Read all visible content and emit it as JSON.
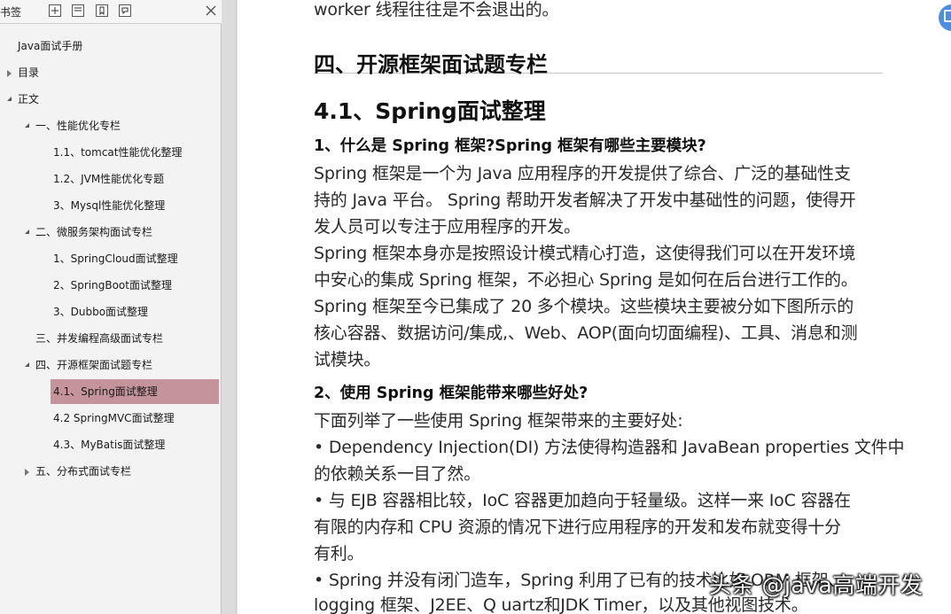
{
  "sidebar": {
    "title": "书签",
    "toolbar_icons": [
      "expand-all-icon",
      "collapse-all-icon",
      "add-bookmark-icon",
      "bookmark-icon"
    ],
    "close_icon": "close-icon",
    "items": [
      {
        "label": "Java面试手册",
        "expander": "none"
      },
      {
        "label": "目录",
        "expander": "closed"
      },
      {
        "label": "正文",
        "expander": "open"
      },
      {
        "label": "一、性能优化专栏",
        "expander": "open"
      },
      {
        "label": "1.1、tomcat性能优化整理",
        "expander": "none"
      },
      {
        "label": "1.2、JVM性能优化专题",
        "expander": "none"
      },
      {
        "label": "3、Mysql性能优化整理",
        "expander": "none"
      },
      {
        "label": "二、微服务架构面试专栏",
        "expander": "open"
      },
      {
        "label": "1、SpringCloud面试整理",
        "expander": "none"
      },
      {
        "label": "2、SpringBoot面试整理",
        "expander": "none"
      },
      {
        "label": "3、Dubbo面试整理",
        "expander": "none"
      },
      {
        "label": "三、并发编程高级面试专栏",
        "expander": "none"
      },
      {
        "label": "四、开源框架面试题专栏",
        "expander": "open"
      },
      {
        "label": "4.1、Spring面试整理",
        "expander": "none",
        "selected": true
      },
      {
        "label": "4.2 SpringMVC面试整理",
        "expander": "none"
      },
      {
        "label": "4.3、MyBatis面试整理",
        "expander": "none"
      },
      {
        "label": "五、分布式面试专栏",
        "expander": "closed"
      }
    ],
    "selected_color": "#c4939b"
  },
  "document": {
    "lines": [
      {
        "text": "worker 线程往往是不会退出的。",
        "style": "body"
      },
      {
        "text": "四、开源框架面试题专栏",
        "style": "h1"
      },
      {
        "text": "4.1、Spring面试整理",
        "style": "h2"
      },
      {
        "text": "1、什么是 Spring 框架?Spring 框架有哪些主要模块?",
        "style": "h3"
      },
      {
        "text": "Spring 框架是一个为 Java 应用程序的开发提供了综合、广泛的基础性支",
        "style": "body"
      },
      {
        "text": "持的 Java 平台。 Spring 帮助开发者解决了开发中基础性的问题，使得开",
        "style": "body"
      },
      {
        "text": "发人员可以专注于应用程序的开发。",
        "style": "body"
      },
      {
        "text": "Spring 框架本身亦是按照设计模式精心打造，这使得我们可以在开发环境",
        "style": "body"
      },
      {
        "text": "中安心的集成 Spring 框架，不必担心 Spring 是如何在后台进行工作的。",
        "style": "body"
      },
      {
        "text": "Spring 框架至今已集成了 20 多个模块。这些模块主要被分如下图所示的",
        "style": "body"
      },
      {
        "text": "核心容器、数据访问/集成,、Web、AOP(面向切面编程)、工具、消息和测",
        "style": "body"
      },
      {
        "text": "试模块。",
        "style": "body"
      },
      {
        "text": "2、使用 Spring 框架能带来哪些好处?",
        "style": "h3"
      },
      {
        "text": "下面列举了一些使用 Spring 框架带来的主要好处:",
        "style": "body"
      },
      {
        "text": "• Dependency Injection(DI) 方法使得构造器和 JavaBean properties 文件中",
        "style": "body"
      },
      {
        "text": "的依赖关系一目了然。",
        "style": "body"
      },
      {
        "text": "• 与 EJB 容器相比较，IoC 容器更加趋向于轻量级。这样一来 IoC 容器在",
        "style": "body"
      },
      {
        "text": "有限的内存和 CPU 资源的情况下进行应用程序的开发和发布就变得十分",
        "style": "body"
      },
      {
        "text": "有利。",
        "style": "body"
      },
      {
        "text": "• Spring 并没有闭门造车，Spring 利用了已有的技术比如 ORM 框架、",
        "style": "body"
      },
      {
        "text": "logging 框架、J2EE、Q uartz和JDK Timer，以及其他视图技术。",
        "style": "body"
      }
    ]
  },
  "overlay": {
    "watermark": "头条 @java高端开发",
    "float_button_icon": "share-icon"
  }
}
